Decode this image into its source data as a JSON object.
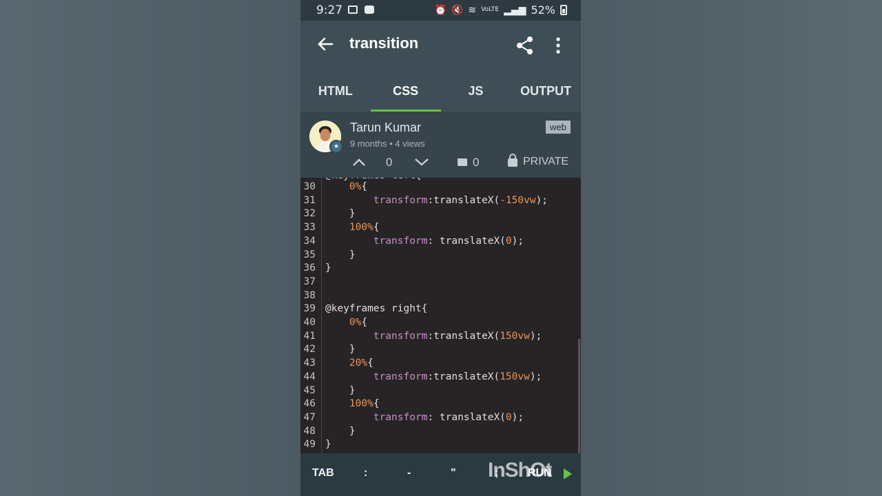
{
  "status_bar": {
    "time": "9:27",
    "signal_text": "VoLTE",
    "battery": "52%"
  },
  "app_bar": {
    "title": "transition"
  },
  "tabs": [
    {
      "label": "HTML",
      "active": false
    },
    {
      "label": "CSS",
      "active": true
    },
    {
      "label": "JS",
      "active": false
    },
    {
      "label": "OUTPUT",
      "active": false
    }
  ],
  "author": {
    "name": "Tarun Kumar",
    "meta": "9 months • 4 views",
    "tag": "web",
    "vote_count": "0",
    "comment_count": "0",
    "visibility": "PRIVATE"
  },
  "editor": {
    "lines": [
      {
        "num": "30",
        "text": "    0%{"
      },
      {
        "num": "31",
        "text": "        transform:translateX(-150vw);"
      },
      {
        "num": "32",
        "text": "    }"
      },
      {
        "num": "33",
        "text": "    100%{"
      },
      {
        "num": "34",
        "text": "        transform: translateX(0);"
      },
      {
        "num": "35",
        "text": "    }"
      },
      {
        "num": "36",
        "text": "}"
      },
      {
        "num": "37",
        "text": ""
      },
      {
        "num": "38",
        "text": ""
      },
      {
        "num": "39",
        "text": "@keyframes right{"
      },
      {
        "num": "40",
        "text": "    0%{"
      },
      {
        "num": "41",
        "text": "        transform:translateX(150vw);"
      },
      {
        "num": "42",
        "text": "    }"
      },
      {
        "num": "43",
        "text": "    20%{"
      },
      {
        "num": "44",
        "text": "        transform:translateX(150vw);"
      },
      {
        "num": "45",
        "text": "    }"
      },
      {
        "num": "46",
        "text": "    100%{"
      },
      {
        "num": "47",
        "text": "        transform: translateX(0);"
      },
      {
        "num": "48",
        "text": "    }"
      },
      {
        "num": "49",
        "text": "}"
      }
    ]
  },
  "toolbar": {
    "tab_key": "TAB",
    "colon_key": ":",
    "dash_key": "-",
    "quote_key": "\"",
    "semicolon_key": ";",
    "run_label": "RUN",
    "watermark": "InShOt"
  },
  "colors": {
    "accent_green": "#6cc04a",
    "appbar": "#3f4e56",
    "editor_bg": "#272426",
    "selector_orange": "#e8955a",
    "property_purple": "#c791c9"
  }
}
